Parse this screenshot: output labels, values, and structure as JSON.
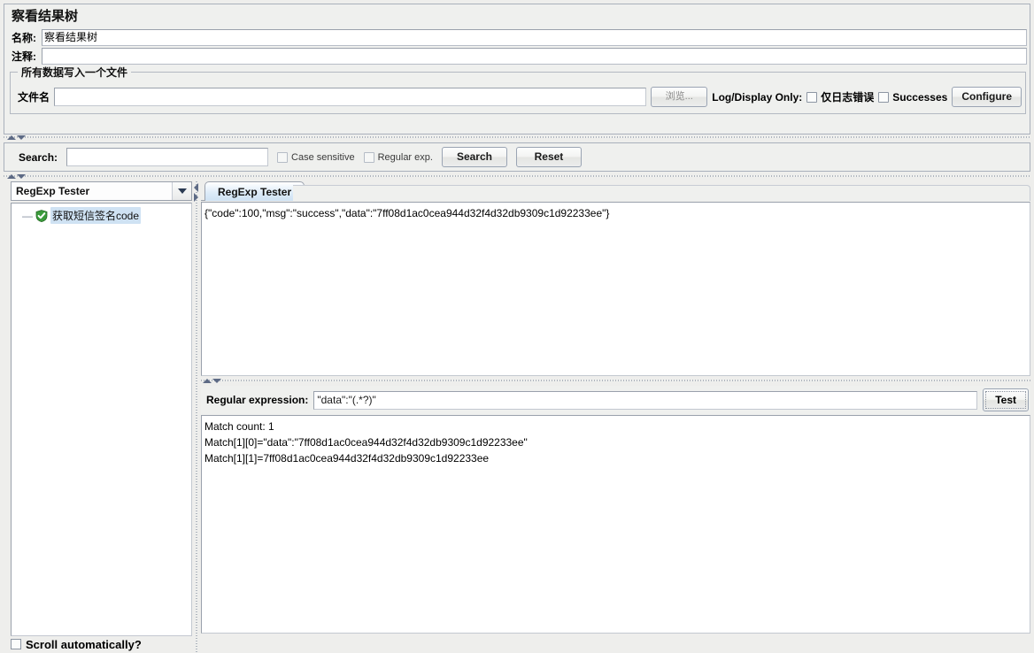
{
  "panel": {
    "title": "察看结果树",
    "name_label": "名称:",
    "name_value": "察看结果树",
    "comment_label": "注释:",
    "comment_value": ""
  },
  "file_group": {
    "legend": "所有数据写入一个文件",
    "filename_label": "文件名",
    "filename_value": "",
    "browse_button": "浏览...",
    "log_display_label": "Log/Display Only:",
    "errors_only_checkbox": "仅日志错误",
    "errors_only_checked": false,
    "successes_checkbox": "Successes",
    "successes_checked": false,
    "configure_button": "Configure"
  },
  "search_bar": {
    "label": "Search:",
    "value": "",
    "case_sensitive_label": "Case sensitive",
    "case_sensitive_checked": false,
    "regular_exp_label": "Regular exp.",
    "regular_exp_checked": false,
    "search_button": "Search",
    "reset_button": "Reset"
  },
  "left_panel": {
    "renderer_selected": "RegExp Tester",
    "tree_node_label": "获取短信签名code",
    "tree_node_handle": "—",
    "scroll_automatically_label": "Scroll automatically?",
    "scroll_automatically_checked": false
  },
  "right_panel": {
    "tab_label": "RegExp Tester",
    "response_text": "{\"code\":100,\"msg\":\"success\",\"data\":\"7ff08d1ac0cea944d32f4d32db9309c1d92233ee\"}",
    "regex_label": "Regular expression:",
    "regex_value": "\"data\":\"(.*?)\"",
    "test_button": "Test",
    "results": {
      "match_count": "Match count: 1",
      "match_1_0": "Match[1][0]=\"data\":\"7ff08d1ac0cea944d32f4d32db9309c1d92233ee\"",
      "match_1_1": "Match[1][1]=7ff08d1ac0cea944d32f4d32db9309c1d92233ee"
    }
  },
  "colors": {
    "panel_bg": "#eff0ee",
    "tab_active": "#cfe2f3",
    "selection": "#cfe2f3",
    "success_green": "#3b9b3b"
  }
}
